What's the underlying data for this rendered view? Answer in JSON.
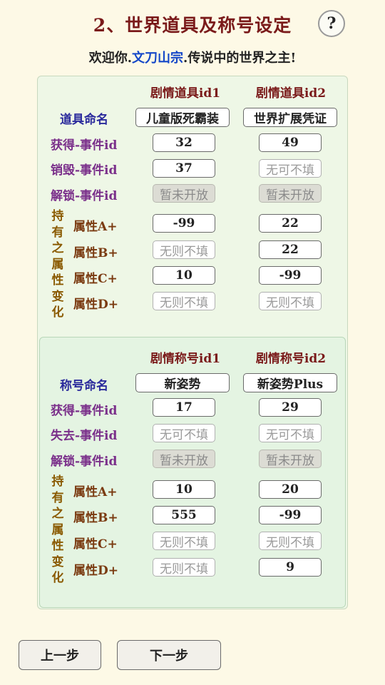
{
  "header": {
    "title": "2、世界道具及称号设定",
    "help_label": "?",
    "welcome_prefix": "欢迎你.",
    "welcome_name": "文刀山宗",
    "welcome_suffix": ".传说中的世界之主!"
  },
  "items": {
    "col1": "剧情道具id1",
    "col2": "剧情道具id2",
    "name_label": "道具命名",
    "name1": "儿童版死霸装",
    "name2": "世界扩展凭证",
    "gain_label": "获得-事件id",
    "gain1": "32",
    "gain2": "49",
    "destroy_label": "销毁-事件id",
    "destroy1": "37",
    "destroy2": "无可不填",
    "unlock_label": "解锁-事件id",
    "unlock1": "暂未开放",
    "unlock2": "暂未开放",
    "hold_chars": [
      "持",
      "有",
      "之",
      "属",
      "性",
      "变",
      "化"
    ],
    "attrA_label": "属性A+",
    "attrA1": "-99",
    "attrA2": "22",
    "attrB_label": "属性B+",
    "attrB1": "无则不填",
    "attrB2": "22",
    "attrC_label": "属性C+",
    "attrC1": "10",
    "attrC2": "-99",
    "attrD_label": "属性D+",
    "attrD1": "无则不填",
    "attrD2": "无则不填"
  },
  "titles": {
    "col1": "剧情称号id1",
    "col2": "剧情称号id2",
    "name_label": "称号命名",
    "name1": "新姿势",
    "name2": "新姿势Plus",
    "gain_label": "获得-事件id",
    "gain1": "17",
    "gain2": "29",
    "lose_label": "失去-事件id",
    "lose1": "无可不填",
    "lose2": "无可不填",
    "unlock_label": "解锁-事件id",
    "unlock1": "暂未开放",
    "unlock2": "暂未开放",
    "hold_chars": [
      "持",
      "有",
      "之",
      "属",
      "性",
      "变",
      "化"
    ],
    "attrA_label": "属性A+",
    "attrA1": "10",
    "attrA2": "20",
    "attrB_label": "属性B+",
    "attrB1": "555",
    "attrB2": "-99",
    "attrC_label": "属性C+",
    "attrC1": "无则不填",
    "attrC2": "无则不填",
    "attrD_label": "属性D+",
    "attrD1": "无则不填",
    "attrD2": "9"
  },
  "footer": {
    "prev_label": "上一步",
    "next_label": "下一步"
  },
  "colors": {
    "title": "#7a1a1a",
    "welcome_name": "#1447c8",
    "event_label": "#7a2f8a",
    "name_label": "#2a2a9c",
    "attr_label": "#7a3a10",
    "hold_label": "#8a5a00",
    "page_bg": "#fdf9e6"
  }
}
